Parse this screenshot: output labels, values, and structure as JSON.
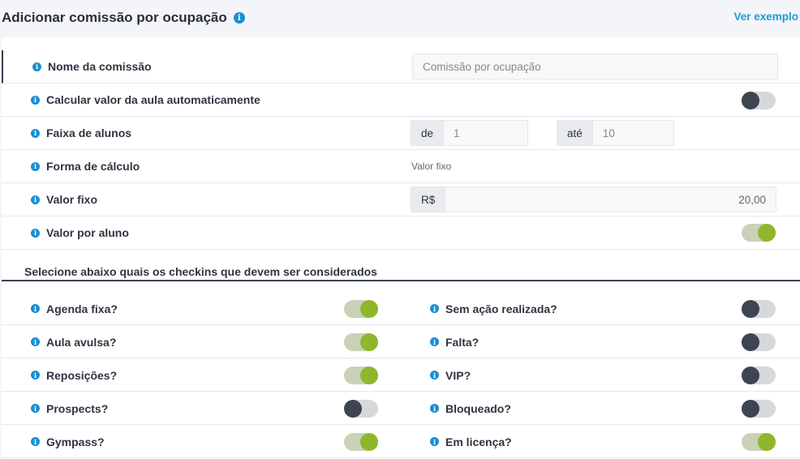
{
  "header": {
    "title": "Adicionar comissão por ocupação",
    "example_link": "Ver exemplo"
  },
  "fields": {
    "nome": {
      "label": "Nome da comissão",
      "placeholder": "Comissão por ocupação"
    },
    "calcular": {
      "label": "Calcular valor da aula automaticamente",
      "on": false
    },
    "faixa": {
      "label": "Faixa de alunos",
      "from_prefix": "de",
      "from_value": "1",
      "to_prefix": "até",
      "to_value": "10"
    },
    "forma": {
      "label": "Forma de cálculo",
      "value": "Valor fixo"
    },
    "valor_fixo": {
      "label": "Valor fixo",
      "currency": "R$",
      "value": "20,00"
    },
    "valor_aluno": {
      "label": "Valor por aluno",
      "on": true
    }
  },
  "checkins": {
    "section_title": "Selecione abaixo quais os checkins que devem ser considerados",
    "left": [
      {
        "label": "Agenda fixa?",
        "on": true
      },
      {
        "label": "Aula avulsa?",
        "on": true
      },
      {
        "label": "Reposições?",
        "on": true
      },
      {
        "label": "Prospects?",
        "on": false
      },
      {
        "label": "Gympass?",
        "on": true
      }
    ],
    "right": [
      {
        "label": "Sem ação realizada?",
        "on": false
      },
      {
        "label": "Falta?",
        "on": false
      },
      {
        "label": "VIP?",
        "on": false
      },
      {
        "label": "Bloqueado?",
        "on": false
      },
      {
        "label": "Em licença?",
        "on": true
      }
    ]
  },
  "colors": {
    "accent": "#1a9cd8",
    "toggle_on": "#8fb72b",
    "toggle_off": "#3e4451"
  },
  "icons": {
    "info": "info-icon"
  }
}
